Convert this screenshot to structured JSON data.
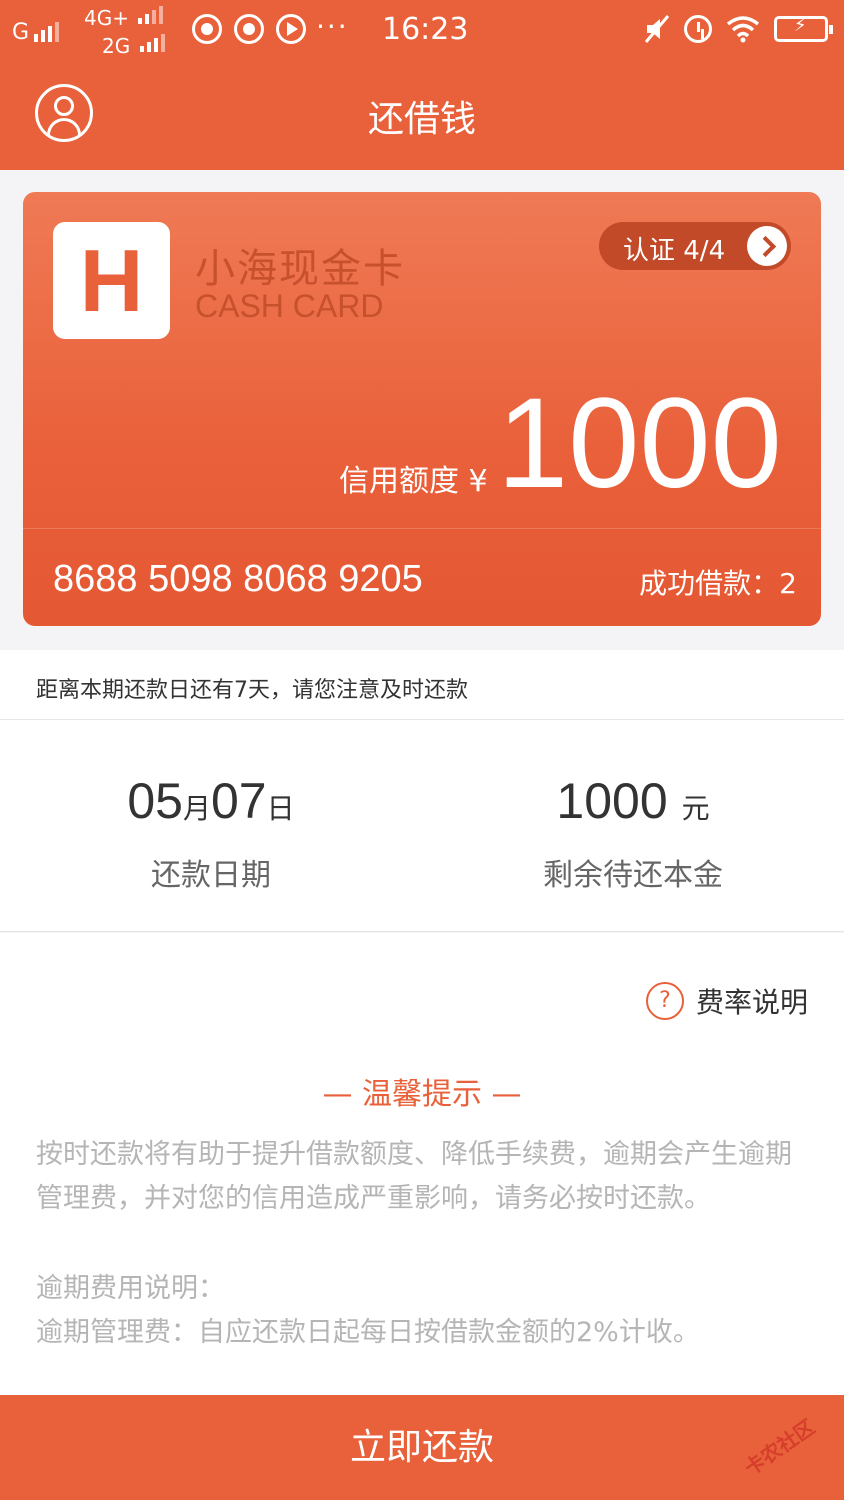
{
  "status_bar": {
    "carrier": "G",
    "network_top": "4G+",
    "network_bottom": "2G",
    "dots": "···",
    "time": "16:23"
  },
  "header": {
    "title": "还借钱",
    "avatar_icon": "user-icon"
  },
  "card": {
    "logo_letter": "H",
    "brand_name": "小海现金卡",
    "brand_name_en": "CASH CARD",
    "auth_label": "认证 4/4",
    "credit_label": "信用额度 ¥",
    "credit_amount": "1000",
    "card_number": "8688 5098 8068 9205",
    "loans_label": "成功借款：2"
  },
  "notice": {
    "text": "距离本期还款日还有7天，请您注意及时还款"
  },
  "summary": {
    "date_month": "05",
    "date_month_unit": "月",
    "date_day": "07",
    "date_day_unit": "日",
    "date_label": "还款日期",
    "principal_value": "1000",
    "principal_unit": "元",
    "principal_label": "剩余待还本金"
  },
  "info": {
    "rate_icon": "question-icon",
    "rate_label": "费率说明",
    "tip_title": "— 温馨提示 —",
    "tip_text": "按时还款将有助于提升借款额度、降低手续费，逾期会产生逾期管理费，并对您的信用造成严重影响，请务必按时还款。",
    "overdue_title": "逾期费用说明：",
    "overdue_text": "逾期管理费：自应还款日起每日按借款金额的2%计收。"
  },
  "action": {
    "pay_label": "立即还款"
  },
  "watermark": {
    "text": "卡农社区"
  },
  "colors": {
    "brand": "#e8613a",
    "card_text_dark": "#c8512d",
    "muted_text": "#b5b5b5"
  }
}
